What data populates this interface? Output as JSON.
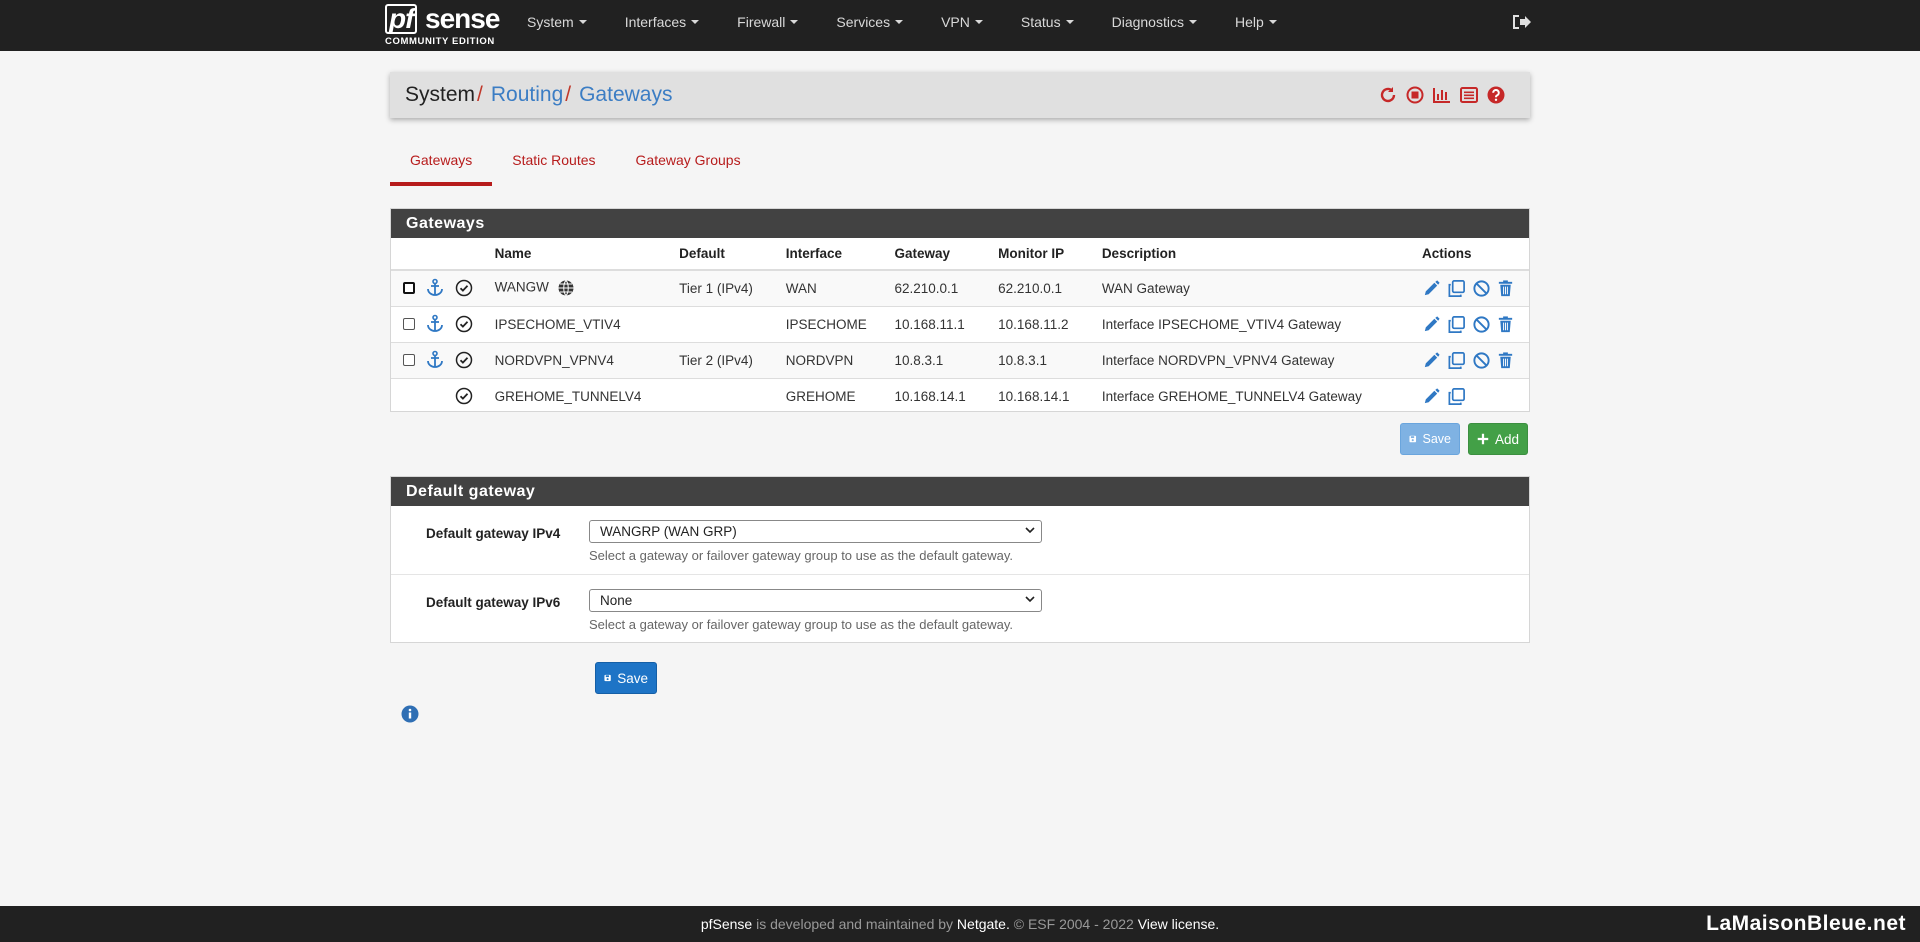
{
  "brand": {
    "logo_pf": "pf",
    "logo_sense": "sense",
    "edition": "COMMUNITY EDITION"
  },
  "nav": {
    "items": [
      "System",
      "Interfaces",
      "Firewall",
      "Services",
      "VPN",
      "Status",
      "Diagnostics",
      "Help"
    ]
  },
  "breadcrumb": {
    "root": "System",
    "sep": "/",
    "level2": "Routing",
    "level3": "Gateways"
  },
  "tabs": [
    "Gateways",
    "Static Routes",
    "Gateway Groups"
  ],
  "gateways_panel": {
    "title": "Gateways",
    "headers": {
      "name": "Name",
      "default": "Default",
      "interface": "Interface",
      "gateway": "Gateway",
      "monitor": "Monitor IP",
      "description": "Description",
      "actions": "Actions"
    },
    "rows": [
      {
        "name": "WANGW",
        "default": "Tier 1 (IPv4)",
        "interface": "WAN",
        "gateway": "62.210.0.1",
        "monitor": "62.210.0.1",
        "description": "WAN Gateway"
      },
      {
        "name": "IPSECHOME_VTIV4",
        "default": "",
        "interface": "IPSECHOME",
        "gateway": "10.168.11.1",
        "monitor": "10.168.11.2",
        "description": "Interface IPSECHOME_VTIV4 Gateway"
      },
      {
        "name": "NORDVPN_VPNV4",
        "default": "Tier 2 (IPv4)",
        "interface": "NORDVPN",
        "gateway": "10.8.3.1",
        "monitor": "10.8.3.1",
        "description": "Interface NORDVPN_VPNV4 Gateway"
      },
      {
        "name": "GREHOME_TUNNELV4",
        "default": "",
        "interface": "GREHOME",
        "gateway": "10.168.14.1",
        "monitor": "10.168.14.1",
        "description": "Interface GREHOME_TUNNELV4 Gateway"
      }
    ],
    "save_label": "Save",
    "add_label": "Add"
  },
  "default_gateway": {
    "title": "Default gateway",
    "ipv4_label": "Default gateway IPv4",
    "ipv4_value": "WANGRP (WAN GRP)",
    "ipv6_label": "Default gateway IPv6",
    "ipv6_value": "None",
    "help": "Select a gateway or failover gateway group to use as the default gateway.",
    "save_label": "Save"
  },
  "footer": {
    "brand": "pfSense",
    "text1": " is developed and maintained by ",
    "company": "Netgate.",
    "text2": " © ESF 2004 - 2022 ",
    "license": "View license.",
    "watermark": "LaMaisonBleue.net"
  },
  "colors": {
    "navbar": "#212121",
    "accent_red": "#b71c1c",
    "link_blue": "#3b7dc4",
    "panel_heading": "#424242",
    "add_green": "#43a047",
    "save_blue": "#1e74c6"
  }
}
